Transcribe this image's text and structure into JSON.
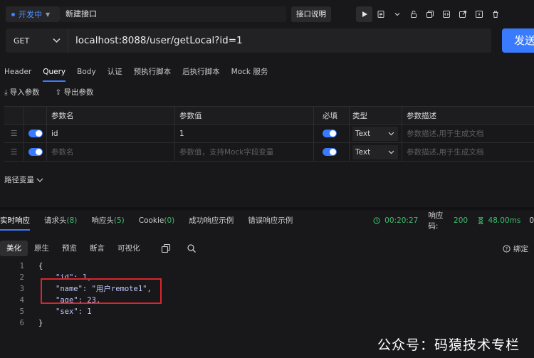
{
  "topbar": {
    "env_label": "开发中",
    "tab_name": "新建接口",
    "doc_button": "接口说明"
  },
  "request": {
    "method": "GET",
    "url": "localhost:8088/user/getLocal?id=1",
    "send_label": "发送"
  },
  "request_tabs": [
    "Header",
    "Query",
    "Body",
    "认证",
    "预执行脚本",
    "后执行脚本",
    "Mock 服务"
  ],
  "param_tools": {
    "import_label": "导入参数",
    "export_label": "导出参数"
  },
  "param_table": {
    "headers": [
      "参数名",
      "参数值",
      "必填",
      "类型",
      "参数描述"
    ],
    "rows": [
      {
        "name": "id",
        "value": "1",
        "type": "Text",
        "desc_placeholder": "参数描述,用于生成文档"
      }
    ],
    "new_row": {
      "name_placeholder": "参数名",
      "value_placeholder": "参数值，支持Mock字段变量",
      "type": "Text",
      "desc_placeholder": "参数描述,用于生成文档"
    }
  },
  "path_variables_label": "路径变量",
  "response_tabs": {
    "realtime": "实时响应",
    "req_headers": "请求头",
    "req_headers_count": "(8)",
    "resp_headers": "响应头",
    "resp_headers_count": "(5)",
    "cookie": "Cookie",
    "cookie_count": "(0)",
    "success_example": "成功响应示例",
    "error_example": "错误响应示例"
  },
  "response_meta": {
    "time": "00:20:27",
    "status_label": "响应码:",
    "status_code": "200",
    "duration": "48.00ms",
    "size": "0"
  },
  "view_modes": [
    "美化",
    "原生",
    "预览",
    "断言",
    "可视化"
  ],
  "bind_label": "绑定",
  "response_body": {
    "line_numbers": [
      "1",
      "2",
      "3",
      "4",
      "5",
      "6"
    ],
    "lines": [
      "{",
      "\"id\": 1,",
      "\"name\": \"用户remote1\",",
      "\"age\": 23,",
      "\"sex\": 1",
      "}"
    ]
  },
  "watermark": "公众号：码猿技术专栏",
  "colors": {
    "accent": "#3a7bfd",
    "success": "#3dbf6e",
    "highlight_box": "#d8262e"
  }
}
